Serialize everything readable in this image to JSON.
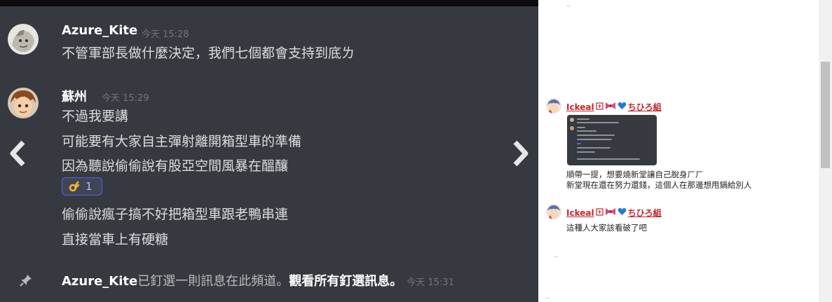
{
  "messages": [
    {
      "username": "Azure_Kite",
      "timestamp": "今天 15:28",
      "lines": [
        "不管軍部長做什麼決定，我們七個都會支持到底ㄌ"
      ]
    },
    {
      "username": "蘇州",
      "timestamp": "今天 15:29",
      "lines": [
        "不過我要講",
        "可能要有大家自主彈射離開箱型車的準備",
        "因為聽說偷偷說有股亞空間風暴在醞釀"
      ],
      "reaction": {
        "emoji": "ok-hand",
        "count": "1"
      },
      "lines_after": [
        "偷偷說瘋子搞不好把箱型車跟老鴨串連",
        "直接當車上有硬糖"
      ]
    }
  ],
  "pin_notice": {
    "user": "Azure_Kite",
    "text": "已釘選一則訊息在此頻道。",
    "link": "觀看所有釘選訊息。",
    "timestamp": "今天 15:31"
  },
  "navigation": {
    "prev_icon": "chevron-left-icon",
    "next_icon": "chevron-right-icon"
  },
  "comments": [
    {
      "username": "Ickeal",
      "has_image": true,
      "lines": [
        "順帶一提，想要燒新堂讓自己脫身ㄏㄏ",
        "新堂現在還在努力還錢，這個人在那邊想甩鍋給別人"
      ]
    },
    {
      "username": "Ickeal",
      "has_image": false,
      "lines": [
        "這種人大家該看破了吧"
      ]
    }
  ],
  "name_suffix": "ちひろ組",
  "colors": {
    "chat_bg": "#36393f",
    "username": "#ffffff",
    "message_text": "#dcddde",
    "timestamp": "#72767d",
    "reaction_border": "#5865f2",
    "comment_name": "#c1272d",
    "heart": "#1e7be0"
  }
}
